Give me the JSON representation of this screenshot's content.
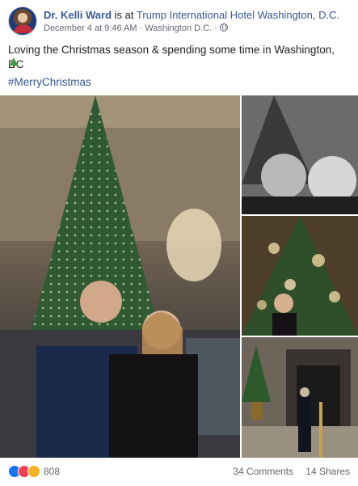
{
  "post": {
    "author": "Dr. Kelli Ward",
    "is_at": " is at ",
    "place": "Trump International Hotel Washington, D.C.",
    "meta": "December 4 at 9:46 AM · Washington D.C. · ",
    "text": "Loving the Christmas season & spending some time in Washington, DC",
    "hashtag": "#MerryChristmas"
  },
  "footer": {
    "reaction_count": "808",
    "comments": "34 Comments",
    "shares": "14 Shares"
  },
  "icons": {
    "avatar": "profile-photo",
    "privacy": "globe-icon",
    "emoji": "christmas-tree-emoji",
    "reactions": [
      "like-icon",
      "love-icon",
      "wow-icon"
    ]
  },
  "colors": {
    "link": "#385898",
    "text": "#1c1e21",
    "meta": "#616770",
    "like": "#1877f2",
    "love": "#f33e58",
    "wow": "#f7b125"
  }
}
